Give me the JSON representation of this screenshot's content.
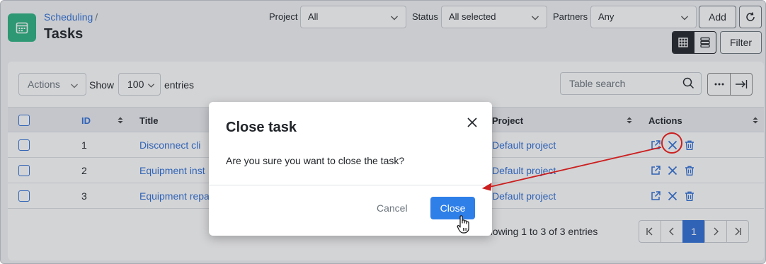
{
  "header": {
    "breadcrumb_link": "Scheduling",
    "breadcrumb_sep": "/",
    "title": "Tasks",
    "app_icon": "calendar-icon"
  },
  "filters": {
    "project_label": "Project",
    "project_value": "All",
    "status_label": "Status",
    "status_value": "All selected",
    "partners_label": "Partners",
    "partners_value": "Any",
    "add_label": "Add",
    "refresh_icon": "refresh-icon",
    "filter_label": "Filter",
    "view_modes": [
      "grid-icon",
      "list-icon"
    ]
  },
  "controls": {
    "actions_label": "Actions",
    "show_label": "Show",
    "entries_value": "100",
    "entries_label": "entries",
    "search_placeholder": "Table search",
    "more_icon": "more-icon",
    "expand_icon": "expand-icon"
  },
  "table": {
    "columns": [
      "ID",
      "Title",
      "Project",
      "Actions"
    ],
    "rows": [
      {
        "id": "1",
        "title": "Disconnect cli",
        "project": "Default project"
      },
      {
        "id": "2",
        "title": "Equipment inst",
        "project": "Default project"
      },
      {
        "id": "3",
        "title": "Equipment repa",
        "project": "Default project"
      }
    ],
    "row_actions": [
      "open-icon",
      "close-icon",
      "trash-icon"
    ]
  },
  "footer": {
    "info": "howing 1 to 3 of 3 entries",
    "pages": [
      "1"
    ],
    "current_page": "1"
  },
  "modal": {
    "title": "Close task",
    "body": "Are you sure you want to close the task?",
    "cancel_label": "Cancel",
    "confirm_label": "Close"
  },
  "colors": {
    "accent": "#2f7fe8",
    "link": "#2f6fd6",
    "app_icon_bg": "#2bb380",
    "annotation": "#cc1f1f"
  }
}
